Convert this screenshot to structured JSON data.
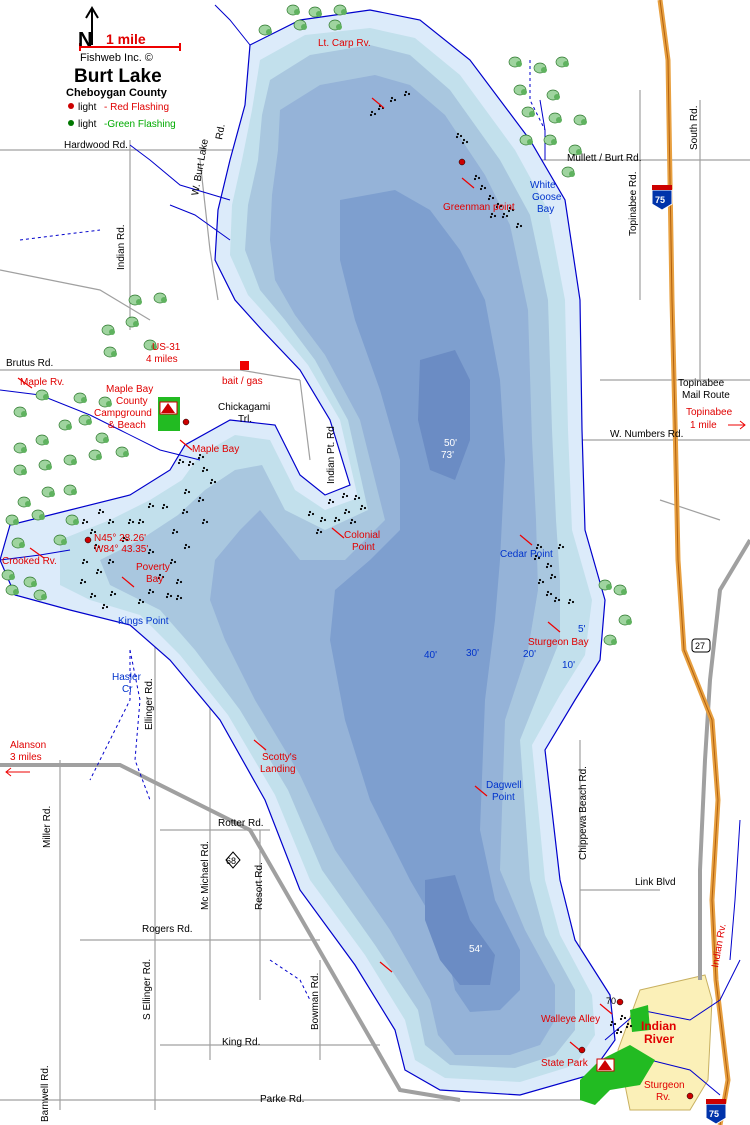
{
  "legend": {
    "north": "N",
    "scale": "1 mile",
    "publisher": "Fishweb Inc. ©",
    "title": "Burt Lake",
    "county": "Cheboygan County",
    "red_light_prefix": "light",
    "red_light_text": "- Red Flashing",
    "green_light_prefix": "light",
    "green_light_text": "-Green Flashing"
  },
  "roads": {
    "hardwood": "Hardwood Rd.",
    "w_burt_lake": "W. Burt Lake",
    "rd_suffix": "Rd.",
    "indian_rd": "Indian Rd.",
    "brutus": "Brutus Rd.",
    "us31_1": "US-31",
    "us31_2": "4 miles",
    "bait": "bait / gas",
    "chickagami_1": "Chickagami",
    "chickagami_2": "Trl.",
    "indian_pt": "Indian Pt. Rd",
    "mullett": "Mullett / Burt Rd.",
    "topinabee_rd": "Topinabee Rd.",
    "south_rd": "South Rd.",
    "topinabee_mail_1": "Topinabee",
    "topinabee_mail_2": "Mail Route",
    "topinabee_dist_1": "Topinabee",
    "topinabee_dist_2": "1 mile",
    "w_numbers": "W. Numbers Rd.",
    "ellinger": "Ellinger Rd.",
    "alanson_1": "Alanson",
    "alanson_2": "3 miles",
    "miller": "Miller Rd.",
    "rotter": "Rotter Rd.",
    "mc_michael": "Mc Michael Rd.",
    "resort": "Resort Rd.",
    "chippewa": "Chippewa Beach Rd.",
    "link": "Link Blvd",
    "rogers": "Rogers Rd.",
    "s_ellinger": "S Ellinger Rd.",
    "bowman": "Bowman Rd.",
    "king": "King Rd.",
    "barnwell": "Barnwell Rd.",
    "parke": "Parke Rd.",
    "indian_rv_road": "Indian Rv."
  },
  "shields": {
    "i75_top": "75",
    "i75_bottom": "75",
    "m27": "27",
    "m68": "68",
    "m70": "70"
  },
  "water": {
    "lt_carp": "Lt. Carp Rv.",
    "greenman": "Greenman point",
    "white_goose_1": "White",
    "white_goose_2": "Goose",
    "white_goose_3": "Bay",
    "maple_rv": "Maple Rv.",
    "maple_bay_cg_1": "Maple Bay",
    "maple_bay_cg_2": "County",
    "maple_bay_cg_3": "Campground",
    "maple_bay_cg_4": "& Beach",
    "maple_bay": "Maple Bay",
    "crooked_rv": "Crooked Rv.",
    "coord_n": "N45° 28.26'",
    "coord_w": "W84° 43.35'",
    "poverty_1": "Poverty",
    "poverty_2": "Bay",
    "kings_point": "Kings Point",
    "colonial_1": "Colonial",
    "colonial_2": "Point",
    "cedar_point": "Cedar Point",
    "sturgeon_bay": "Sturgeon Bay",
    "hasler_1": "Hasler",
    "hasler_2": "Cr",
    "scottys_1": "Scotty's",
    "scottys_2": "Landing",
    "dagwell_1": "Dagwell",
    "dagwell_2": "Point",
    "walleye_alley": "Walleye Alley",
    "state_park": "State Park",
    "indian_river_1": "Indian",
    "indian_river_2": "River",
    "sturgeon_rv_1": "Sturgeon",
    "sturgeon_rv_2": "Rv."
  },
  "depths": {
    "d50": "50'",
    "d73": "73'",
    "d40": "40'",
    "d30": "30'",
    "d20": "20'",
    "d5": "5'",
    "d10": "10'",
    "d54": "54'"
  },
  "colors": {
    "shallow": "#dcebfa",
    "mid": "#c2e0ec",
    "mid2": "#a9c7df",
    "deep": "#95b3d8",
    "deepest": "#7e9fcf",
    "shore": "#0000cc",
    "road": "#a0a0a0",
    "interstate": "#e8a040",
    "park": "#22bb22",
    "town": "#fbf0b8"
  }
}
